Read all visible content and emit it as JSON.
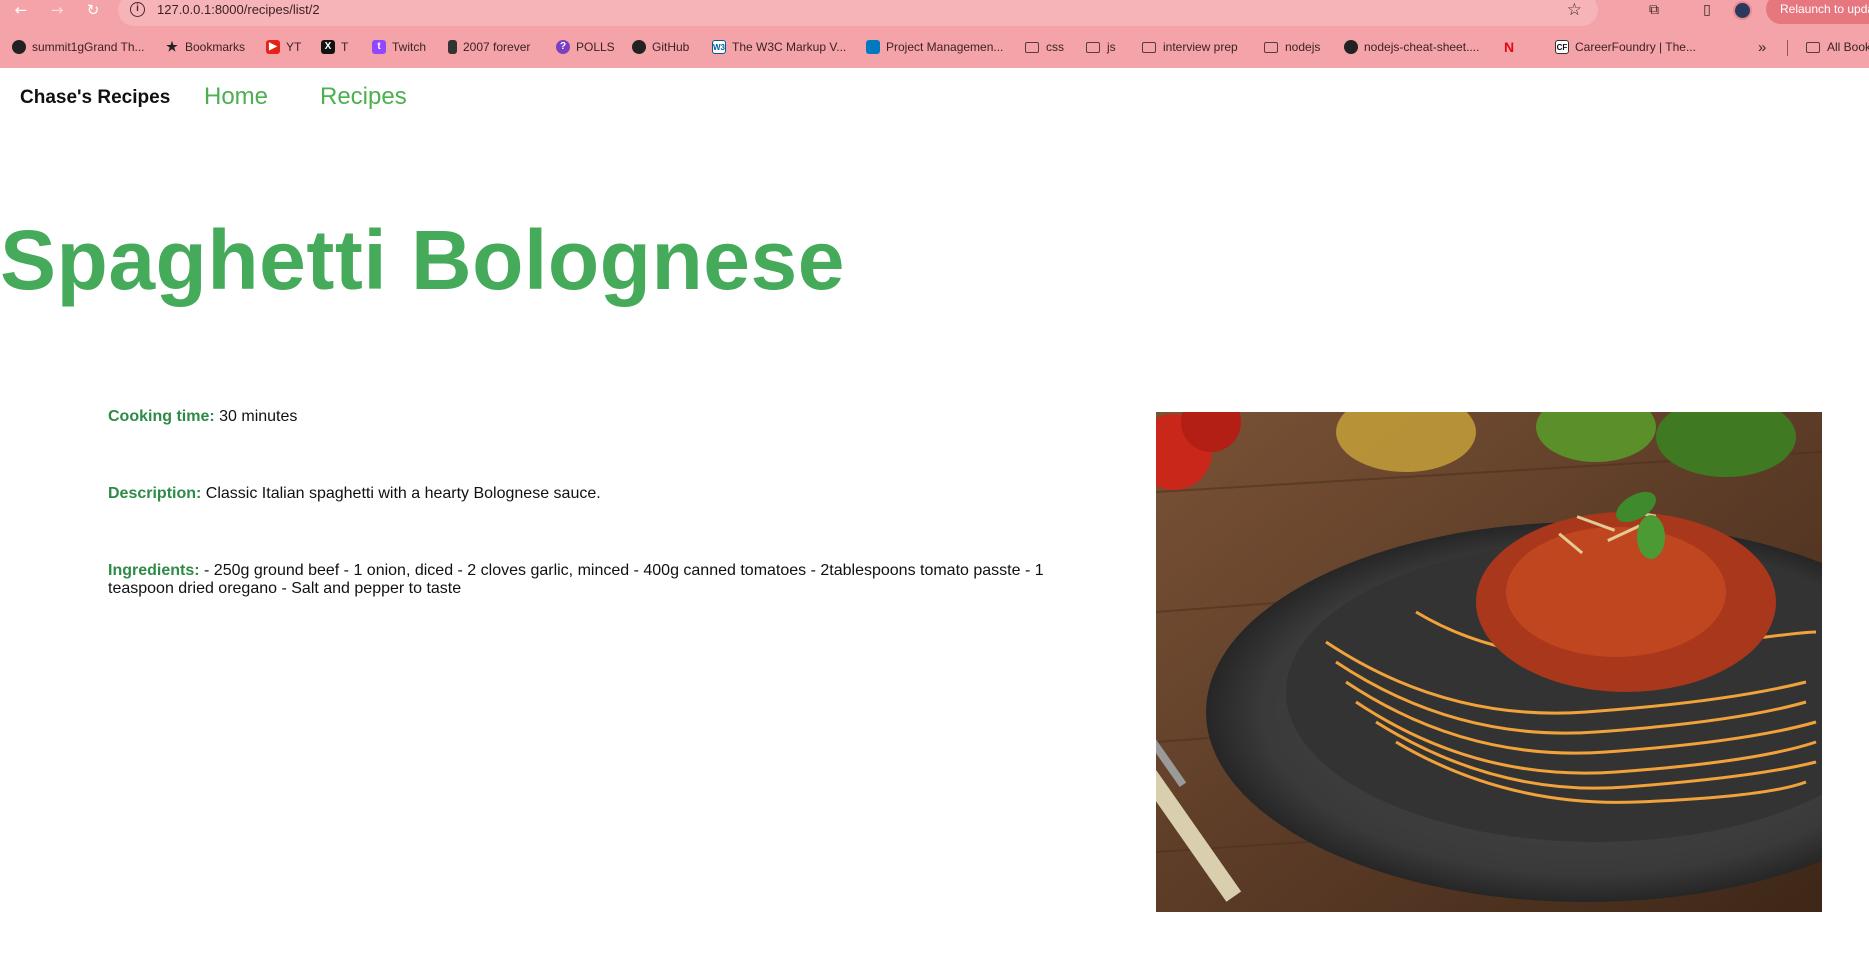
{
  "browser": {
    "url": "127.0.0.1:8000/recipes/list/2",
    "relaunch_label": "Relaunch to update",
    "bookmarks": [
      {
        "label": "summit1gGrand Th...",
        "icon": "twitch-globe-icon"
      },
      {
        "label": "Bookmarks",
        "icon": "star-icon"
      },
      {
        "label": "YT",
        "icon": "youtube-icon"
      },
      {
        "label": "T",
        "icon": "x-icon"
      },
      {
        "label": "Twitch",
        "icon": "twitch-icon"
      },
      {
        "label": "2007 forever",
        "icon": "page-icon"
      },
      {
        "label": "POLLS",
        "icon": "polls-icon"
      },
      {
        "label": "GitHub",
        "icon": "github-icon"
      },
      {
        "label": "The W3C Markup V...",
        "icon": "w3c-icon"
      },
      {
        "label": "Project Managemen...",
        "icon": "trello-icon"
      },
      {
        "label": "css",
        "icon": "folder-icon"
      },
      {
        "label": "js",
        "icon": "folder-icon"
      },
      {
        "label": "interview prep",
        "icon": "folder-icon"
      },
      {
        "label": "nodejs",
        "icon": "folder-icon"
      },
      {
        "label": "nodejs-cheat-sheet....",
        "icon": "globe-icon"
      },
      {
        "label": "",
        "icon": "netflix-icon"
      },
      {
        "label": "CareerFoundry | The...",
        "icon": "careerfoundry-icon"
      }
    ],
    "all_bookmarks_label": "All Bookmarks",
    "overflow_label": "»"
  },
  "site": {
    "brand": "Chase's Recipes",
    "nav": [
      {
        "label": "Home"
      },
      {
        "label": "Recipes"
      }
    ]
  },
  "recipe": {
    "title": "Spaghetti Bolognese",
    "cooking_time_label": "Cooking time:",
    "cooking_time": "30 minutes",
    "description_label": "Description:",
    "description": "Classic Italian spaghetti with a hearty Bolognese sauce.",
    "ingredients_label": "Ingredients:",
    "ingredients": "- 250g ground beef - 1 onion, diced - 2 cloves garlic, minced - 400g canned tomatoes - 2tablespoons tomato passte - 1 teaspoon dried oregano - Salt and pepper to taste"
  },
  "colors": {
    "chrome": "#f4a3a8",
    "accent_green": "#45aa5a",
    "label_green": "#2e8b47"
  }
}
